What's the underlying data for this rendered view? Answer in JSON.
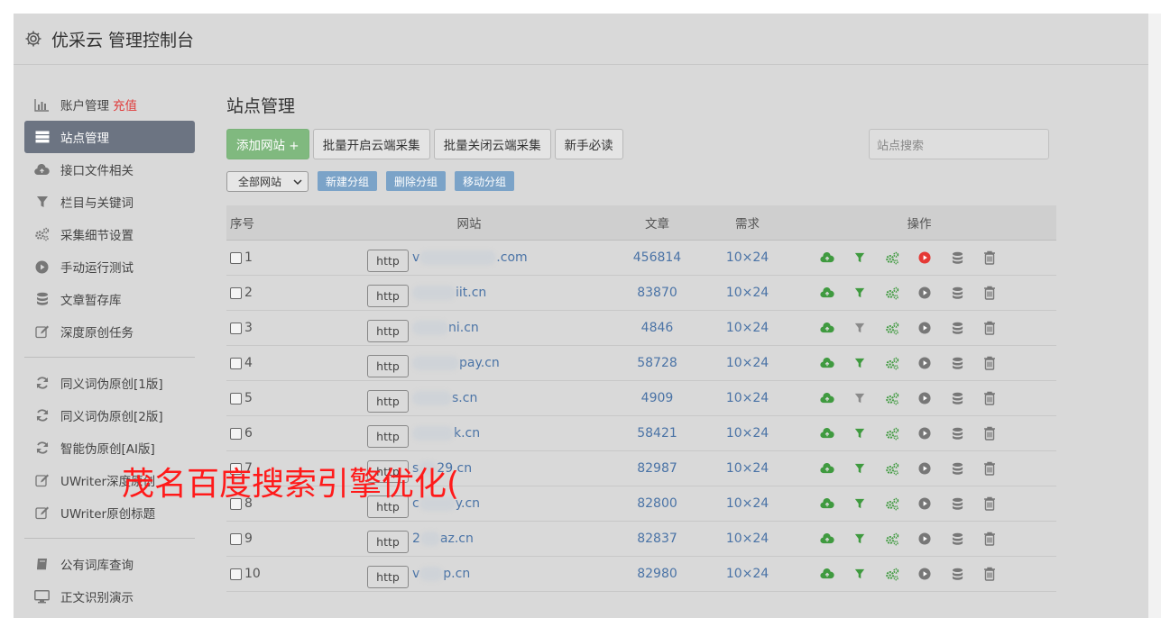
{
  "header": {
    "title": "优采云 管理控制台"
  },
  "sidebar": {
    "items": [
      {
        "label": "账户管理",
        "extra": "充值",
        "icon": "bar-chart-icon"
      },
      {
        "label": "站点管理",
        "icon": "server-icon",
        "active": true
      },
      {
        "label": "接口文件相关",
        "icon": "cloud-upload-icon"
      },
      {
        "label": "栏目与关键词",
        "icon": "filter-icon"
      },
      {
        "label": "采集细节设置",
        "icon": "gears-icon"
      },
      {
        "label": "手动运行测试",
        "icon": "play-circle-icon"
      },
      {
        "label": "文章暂存库",
        "icon": "database-icon"
      },
      {
        "label": "深度原创任务",
        "icon": "edit-icon"
      }
    ],
    "items2": [
      {
        "label": "同义词伪原创[1版]",
        "icon": "refresh-icon"
      },
      {
        "label": "同义词伪原创[2版]",
        "icon": "refresh-icon"
      },
      {
        "label": "智能伪原创[AI版]",
        "icon": "refresh-icon"
      },
      {
        "label": "UWriter深度原创",
        "icon": "edit-icon"
      },
      {
        "label": "UWriter原创标题",
        "icon": "edit-icon"
      }
    ],
    "items3": [
      {
        "label": "公有词库查询",
        "icon": "book-icon"
      },
      {
        "label": "正文识别演示",
        "icon": "desktop-icon"
      }
    ]
  },
  "main": {
    "title": "站点管理",
    "toolbar": {
      "add_site": "添加网站 +",
      "batch_on": "批量开启云端采集",
      "batch_off": "批量关闭云端采集",
      "guide": "新手必读",
      "search_placeholder": "站点搜索"
    },
    "group": {
      "select_value": "全部网站",
      "new_group": "新建分组",
      "delete_group": "删除分组",
      "move_group": "移动分组"
    },
    "table": {
      "headers": {
        "no": "序号",
        "site": "网站",
        "articles": "文章",
        "demand": "需求",
        "ops": "操作"
      },
      "http_label": "http",
      "rows": [
        {
          "no": "1",
          "prefix": "v",
          "domain": ".com",
          "articles": "456814",
          "demand": "10×24",
          "filter_active": true,
          "run_active": true
        },
        {
          "no": "2",
          "prefix": "",
          "domain": "iit.cn",
          "articles": "83870",
          "demand": "10×24",
          "filter_active": true,
          "run_active": false
        },
        {
          "no": "3",
          "prefix": "",
          "domain": "ni.cn",
          "articles": "4846",
          "demand": "10×24",
          "filter_active": false,
          "run_active": false
        },
        {
          "no": "4",
          "prefix": "",
          "domain": "pay.cn",
          "articles": "58728",
          "demand": "10×24",
          "filter_active": true,
          "run_active": false
        },
        {
          "no": "5",
          "prefix": "",
          "domain": "s.cn",
          "articles": "4909",
          "demand": "10×24",
          "filter_active": false,
          "run_active": false
        },
        {
          "no": "6",
          "prefix": "",
          "domain": "k.cn",
          "articles": "58421",
          "demand": "10×24",
          "filter_active": true,
          "run_active": false
        },
        {
          "no": "7",
          "prefix": "s",
          "domain": "29.cn",
          "articles": "82987",
          "demand": "10×24",
          "filter_active": true,
          "run_active": false
        },
        {
          "no": "8",
          "prefix": "c",
          "domain": "y.cn",
          "articles": "82800",
          "demand": "10×24",
          "filter_active": true,
          "run_active": false
        },
        {
          "no": "9",
          "prefix": "2",
          "domain": "az.cn",
          "articles": "82837",
          "demand": "10×24",
          "filter_active": true,
          "run_active": false
        },
        {
          "no": "10",
          "prefix": "v",
          "domain": "p.cn",
          "articles": "82980",
          "demand": "10×24",
          "filter_active": true,
          "run_active": false
        }
      ]
    }
  },
  "overlay": {
    "text": "茂名百度搜索引擎优化("
  },
  "colors": {
    "green_icon": "#3f9a3f",
    "run_red": "#e53935",
    "link_blue": "#4a73a6",
    "active_sidebar": "#6c7482",
    "add_button": "#80b97f",
    "group_button": "#7ba3c8",
    "overlay_red": "#ff1a1a"
  }
}
